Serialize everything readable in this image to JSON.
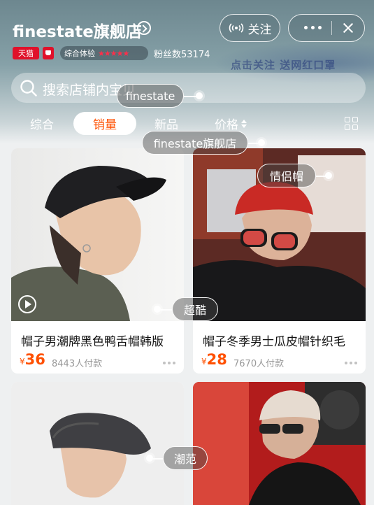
{
  "header": {
    "store_name": "finestate旗舰店",
    "follow_label": "关注",
    "tmall_badge": "天猫",
    "rating_label": "综合体验",
    "rating_stars": "★★★★★",
    "fans_label": "粉丝数53174",
    "banner_text": "点击关注 送网红口罩"
  },
  "search": {
    "placeholder": "搜索店铺内宝贝"
  },
  "tabs": [
    {
      "label": "综合"
    },
    {
      "label": "销量"
    },
    {
      "label": "新品"
    },
    {
      "label": "价格"
    }
  ],
  "products": [
    {
      "title": "帽子男潮牌黑色鸭舌帽韩版",
      "price": "36",
      "currency": "¥",
      "sold": "8443人付款"
    },
    {
      "title": "帽子冬季男士瓜皮帽针织毛",
      "price": "28",
      "currency": "¥",
      "sold": "7670人付款"
    },
    {
      "title": "",
      "price": "",
      "currency": "",
      "sold": ""
    },
    {
      "title": "",
      "price": "",
      "currency": "",
      "sold": ""
    }
  ],
  "floating_tags": [
    "finestate",
    "finestate旗舰店",
    "情侣帽",
    "超酷",
    "潮范"
  ],
  "colors": {
    "accent": "#ff5000",
    "tmall_red": "#e0112a",
    "header": "#6d878f"
  },
  "icons": [
    "search-icon",
    "chevron-right-icon",
    "signal-icon",
    "more-icon",
    "close-icon",
    "grid-view-icon",
    "play-icon"
  ]
}
